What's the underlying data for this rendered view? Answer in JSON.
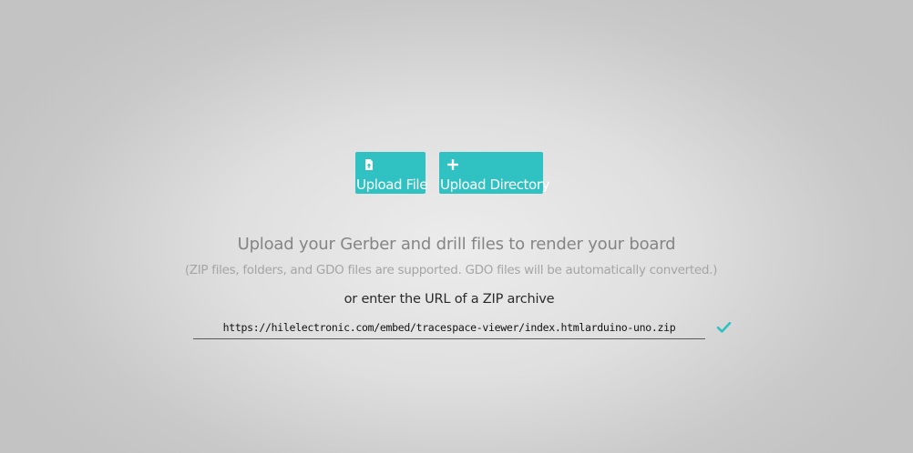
{
  "upload": {
    "file_button": {
      "label": "Upload File",
      "icon": "file-upload-icon"
    },
    "directory_button": {
      "label": "Upload Directory",
      "icon": "plus-icon"
    }
  },
  "instructions": {
    "heading": "Upload your Gerber and drill files to render your board",
    "subheading": "(ZIP files, folders, and GDO files are supported. GDO files will be automatically converted.)"
  },
  "url_entry": {
    "label": "or enter the URL of a ZIP archive",
    "value": "https://hilelectronic.com/embed/tracespace-viewer/index.htmlarduino-uno.zip",
    "submit_icon": "checkmark-icon"
  },
  "colors": {
    "accent": "#30c2c2",
    "button_text": "#ffffff",
    "heading_text": "#858585",
    "subheading_text": "#a5a5a5"
  }
}
